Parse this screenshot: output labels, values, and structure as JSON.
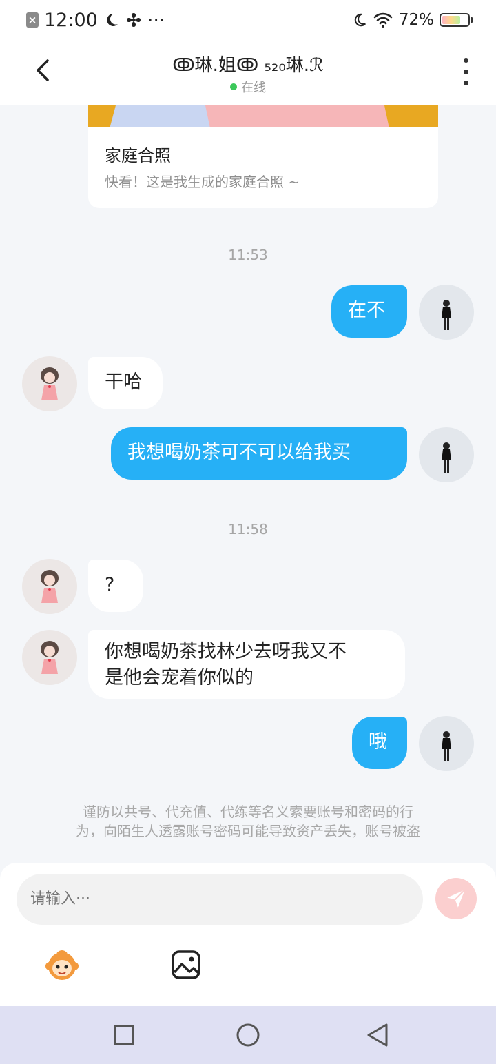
{
  "status_bar": {
    "time": "12:00",
    "extra": "···",
    "battery": "72%",
    "battery_level": 0.72
  },
  "header": {
    "contact_name": "ↂ琳.姐ↂ ₅₂₀琳.ℛ",
    "status": "在线"
  },
  "card": {
    "title": "家庭合照",
    "description": "快看！这是我生成的家庭合照 ~"
  },
  "messages": {
    "time1": "11:53",
    "m1": "在不",
    "m2": "干哈",
    "m3": "我想喝奶茶可不可以给我买",
    "time2": "11:58",
    "m4": "?",
    "m5_line1": "你想喝奶茶找林少去呀我又不",
    "m5_line2": "是他会宠着你似的",
    "m6": "哦"
  },
  "notice": {
    "line1": "谨防以共号、代充值、代练等名义索要账号和密码的行",
    "line2": "为，向陌生人透露账号密码可能导致资产丢失，账号被盗"
  },
  "input": {
    "placeholder": "请输入···"
  },
  "icons": {
    "back": "back-arrow-icon",
    "more": "more-vertical-icon",
    "send": "send-icon",
    "emoji": "emoji-mascot-icon",
    "image": "image-icon",
    "nav_recent": "square-icon",
    "nav_home": "circle-icon",
    "nav_back": "triangle-back-icon"
  },
  "colors": {
    "accent": "#26b0f6",
    "online": "#3cc85a",
    "send_disabled": "#fbcfcf",
    "navbar": "#dfe0f3"
  }
}
